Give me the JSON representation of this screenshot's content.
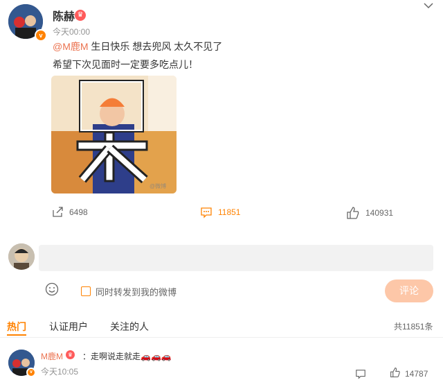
{
  "post": {
    "author": "陈赫",
    "timestamp": "今天00:00",
    "mention": "@M鹿M",
    "line1_rest": " 生日快乐 想去兜风 太久不见了",
    "line2": "希望下次见面时一定要多吃点儿！",
    "image_alt": "呆",
    "image_watermark": "@微博"
  },
  "actions": {
    "share_count": "6498",
    "comment_count": "11851",
    "like_count": "140931"
  },
  "composer": {
    "placeholder": "",
    "forward_label": "同时转发到我的微博",
    "submit_label": "评论"
  },
  "tabs": {
    "hot": "热门",
    "verified": "认证用户",
    "following": "关注的人",
    "total": "共11851条"
  },
  "comment": {
    "user": "M鹿M",
    "text": "：走啊说走就走🚗🚗🚗",
    "time": "今天10:05",
    "like_count": "14787"
  },
  "icons": {
    "menu": "chevron-down-icon",
    "share": "share-icon",
    "comment": "comment-icon",
    "like": "thumbs-up-icon",
    "emoji": "emoji-icon",
    "reply": "reply-icon"
  },
  "colors": {
    "accent": "#ff8200",
    "mention": "#eb7350",
    "submit_bg": "#fdc7a8"
  }
}
